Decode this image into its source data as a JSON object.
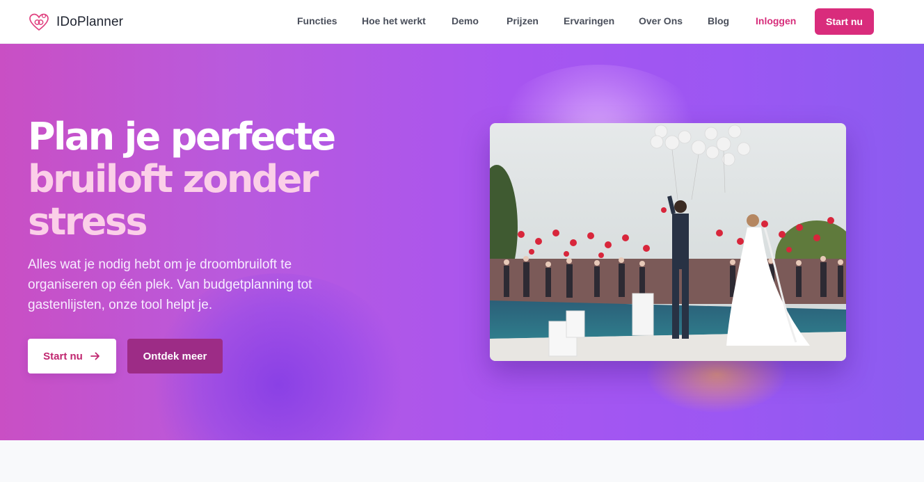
{
  "brand": {
    "name": "IDoPlanner",
    "accent": "#d92c7c"
  },
  "nav": {
    "links": [
      "Functies",
      "Hoe het werkt",
      "Demo",
      "Prijzen",
      "Ervaringen",
      "Over Ons",
      "Blog"
    ],
    "login": "Inloggen",
    "cta": "Start nu"
  },
  "hero": {
    "headline_line1": "Plan je perfecte",
    "headline_line2": "bruiloft zonder",
    "headline_line3": "stress",
    "subtitle": "Alles wat je nodig hebt om je droombruiloft te organiseren op één plek. Van budgetplanning tot gastenlijsten, onze tool helpt je.",
    "primary_button": "Start nu",
    "secondary_button": "Ontdek meer",
    "gradient_from": "#c94fc4",
    "gradient_to": "#8b5cf0"
  },
  "icons": {
    "logo": "heart-rings-icon",
    "primary_button_icon": "arrow-right-icon"
  }
}
